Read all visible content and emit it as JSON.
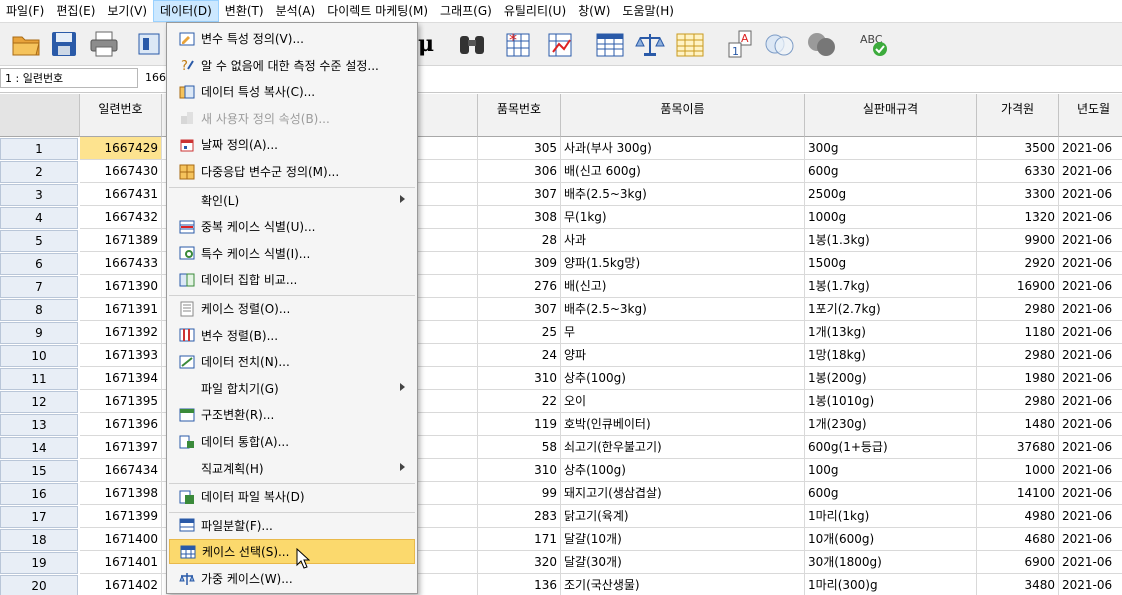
{
  "menubar": [
    {
      "label": "파일(F)",
      "active": false
    },
    {
      "label": "편집(E)",
      "active": false
    },
    {
      "label": "보기(V)",
      "active": false
    },
    {
      "label": "데이터(D)",
      "active": true
    },
    {
      "label": "변환(T)",
      "active": false
    },
    {
      "label": "분석(A)",
      "active": false
    },
    {
      "label": "다이렉트 마케팅(M)",
      "active": false
    },
    {
      "label": "그래프(G)",
      "active": false
    },
    {
      "label": "유틸리티(U)",
      "active": false
    },
    {
      "label": "창(W)",
      "active": false
    },
    {
      "label": "도움말(H)",
      "active": false
    }
  ],
  "toolbar_icons": [
    "open-folder-icon",
    "save-icon",
    "print-icon",
    "dialog-recall-icon",
    "mu-icon",
    "binoculars-icon",
    "star-grid-icon",
    "chart-grid-icon",
    "table-icon",
    "scale-icon",
    "value-labels-icon",
    "a1-icon",
    "circles-icon",
    "grey-circles-icon",
    "spellcheck-icon"
  ],
  "toolbar_text": {
    "mu": "μ",
    "abc": "ABC",
    "a1_top": "A",
    "a1_bottom": "1"
  },
  "cell_editor": {
    "name": "1 : 일련번호",
    "value": "166"
  },
  "columns": [
    "일련번호",
    "품목번호",
    "품목이름",
    "실판매규격",
    "가격원",
    "년도월"
  ],
  "rows": [
    {
      "n": "1",
      "id": "1667429",
      "code": "305",
      "name": "사과(부사 300g)",
      "spec": "300g",
      "price": "3500",
      "ym": "2021-06"
    },
    {
      "n": "2",
      "id": "1667430",
      "code": "306",
      "name": "배(신고 600g)",
      "spec": "600g",
      "price": "6330",
      "ym": "2021-06"
    },
    {
      "n": "3",
      "id": "1667431",
      "code": "307",
      "name": "배추(2.5~3kg)",
      "spec": "2500g",
      "price": "3300",
      "ym": "2021-06"
    },
    {
      "n": "4",
      "id": "1667432",
      "code": "308",
      "name": "무(1kg)",
      "spec": "1000g",
      "price": "1320",
      "ym": "2021-06"
    },
    {
      "n": "5",
      "id": "1671389",
      "code": "28",
      "name": "사과",
      "spec": "1봉(1.3kg)",
      "price": "9900",
      "ym": "2021-06"
    },
    {
      "n": "6",
      "id": "1667433",
      "code": "309",
      "name": "양파(1.5kg망)",
      "spec": "1500g",
      "price": "2920",
      "ym": "2021-06"
    },
    {
      "n": "7",
      "id": "1671390",
      "code": "276",
      "name": "배(신고)",
      "spec": "1봉(1.7kg)",
      "price": "16900",
      "ym": "2021-06"
    },
    {
      "n": "8",
      "id": "1671391",
      "code": "307",
      "name": "배추(2.5~3kg)",
      "spec": "1포기(2.7kg)",
      "price": "2980",
      "ym": "2021-06"
    },
    {
      "n": "9",
      "id": "1671392",
      "code": "25",
      "name": "무",
      "spec": "1개(13kg)",
      "price": "1180",
      "ym": "2021-06"
    },
    {
      "n": "10",
      "id": "1671393",
      "code": "24",
      "name": "양파",
      "spec": "1망(18kg)",
      "price": "2980",
      "ym": "2021-06"
    },
    {
      "n": "11",
      "id": "1671394",
      "code": "310",
      "name": "상추(100g)",
      "spec": "1봉(200g)",
      "price": "1980",
      "ym": "2021-06"
    },
    {
      "n": "12",
      "id": "1671395",
      "code": "22",
      "name": "오이",
      "spec": "1봉(1010g)",
      "price": "2980",
      "ym": "2021-06"
    },
    {
      "n": "13",
      "id": "1671396",
      "code": "119",
      "name": "호박(인큐베이터)",
      "spec": "1개(230g)",
      "price": "1480",
      "ym": "2021-06"
    },
    {
      "n": "14",
      "id": "1671397",
      "code": "58",
      "name": "쇠고기(한우불고기)",
      "spec": "600g(1+등급)",
      "price": "37680",
      "ym": "2021-06"
    },
    {
      "n": "15",
      "id": "1667434",
      "code": "310",
      "name": "상추(100g)",
      "spec": "100g",
      "price": "1000",
      "ym": "2021-06"
    },
    {
      "n": "16",
      "id": "1671398",
      "code": "99",
      "name": "돼지고기(생삼겹살)",
      "spec": "600g",
      "price": "14100",
      "ym": "2021-06"
    },
    {
      "n": "17",
      "id": "1671399",
      "code": "283",
      "name": "닭고기(육계)",
      "spec": "1마리(1kg)",
      "price": "4980",
      "ym": "2021-06"
    },
    {
      "n": "18",
      "id": "1671400",
      "code": "171",
      "name": "달걀(10개)",
      "spec": "10개(600g)",
      "price": "4680",
      "ym": "2021-06"
    },
    {
      "n": "19",
      "id": "1671401",
      "code": "320",
      "name": "달걀(30개)",
      "spec": "30개(1800g)",
      "price": "6900",
      "ym": "2021-06"
    },
    {
      "n": "20",
      "id": "1671402",
      "code": "136",
      "name": "조기(국산생물)",
      "spec": "1마리(300)g",
      "price": "3480",
      "ym": "2021-06"
    }
  ],
  "dropdown": [
    {
      "type": "item",
      "label": "변수 특성 정의(V)...",
      "icon": "define-variable-properties-icon",
      "disabled": false
    },
    {
      "type": "item",
      "label": "알 수 없음에 대한 측정 수준 설정...",
      "icon": "measurement-level-icon",
      "disabled": false
    },
    {
      "type": "item",
      "label": "데이터 특성 복사(C)...",
      "icon": "copy-properties-icon",
      "disabled": false
    },
    {
      "type": "item",
      "label": "새 사용자 정의 속성(B)...",
      "icon": "custom-attribute-icon",
      "disabled": true
    },
    {
      "type": "item",
      "label": "날짜 정의(A)...",
      "icon": "calendar-icon",
      "disabled": false
    },
    {
      "type": "item",
      "label": "다중응답 변수군 정의(M)...",
      "icon": "multiple-response-icon",
      "disabled": false
    },
    {
      "type": "sep"
    },
    {
      "type": "item",
      "label": "확인(L)",
      "icon": "",
      "submenu": true,
      "disabled": false
    },
    {
      "type": "item",
      "label": "중복 케이스 식별(U)...",
      "icon": "duplicate-cases-icon",
      "disabled": false
    },
    {
      "type": "item",
      "label": "특수 케이스 식별(I)...",
      "icon": "unusual-cases-icon",
      "disabled": false
    },
    {
      "type": "item",
      "label": "데이터 집합 비교...",
      "icon": "compare-datasets-icon",
      "disabled": false
    },
    {
      "type": "sep"
    },
    {
      "type": "item",
      "label": "케이스 정렬(O)...",
      "icon": "sort-cases-icon",
      "disabled": false
    },
    {
      "type": "item",
      "label": "변수 정렬(B)...",
      "icon": "sort-variables-icon",
      "disabled": false
    },
    {
      "type": "item",
      "label": "데이터 전치(N)...",
      "icon": "transpose-icon",
      "disabled": false
    },
    {
      "type": "item",
      "label": "파일 합치기(G)",
      "icon": "",
      "submenu": true,
      "disabled": false
    },
    {
      "type": "item",
      "label": "구조변환(R)...",
      "icon": "restructure-icon",
      "disabled": false
    },
    {
      "type": "item",
      "label": "데이터 통합(A)...",
      "icon": "aggregate-icon",
      "disabled": false
    },
    {
      "type": "item",
      "label": "직교계획(H)",
      "icon": "",
      "submenu": true,
      "disabled": false
    },
    {
      "type": "sep"
    },
    {
      "type": "item",
      "label": "데이터 파일 복사(D)",
      "icon": "copy-dataset-icon",
      "disabled": false
    },
    {
      "type": "sep"
    },
    {
      "type": "item",
      "label": "파일분할(F)...",
      "icon": "split-file-icon",
      "disabled": false
    },
    {
      "type": "item",
      "label": "케이스 선택(S)...",
      "icon": "select-cases-icon",
      "disabled": false,
      "highlighted": true
    },
    {
      "type": "item",
      "label": "가중 케이스(W)...",
      "icon": "weight-cases-icon",
      "disabled": false
    }
  ],
  "colors": {
    "selected_cell": "#fde38f",
    "highlight": "#fbd96d",
    "menu_active": "#cce8ff"
  }
}
